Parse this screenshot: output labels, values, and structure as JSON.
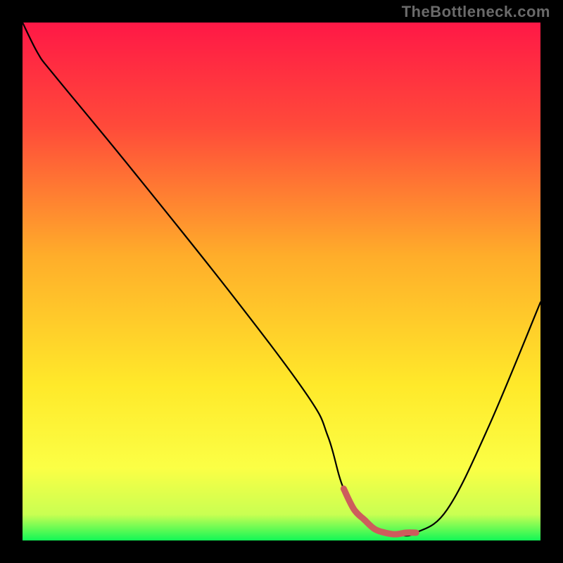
{
  "watermark": "TheBottleneck.com",
  "chart_data": {
    "type": "line",
    "title": "",
    "xlabel": "",
    "ylabel": "",
    "xlim": [
      0,
      100
    ],
    "ylim": [
      0,
      100
    ],
    "grid": false,
    "legend": false,
    "gradient_stops": [
      {
        "offset": 0,
        "color": "#ff1846"
      },
      {
        "offset": 20,
        "color": "#ff4a3a"
      },
      {
        "offset": 45,
        "color": "#ffad2a"
      },
      {
        "offset": 70,
        "color": "#ffe92a"
      },
      {
        "offset": 86,
        "color": "#fbff45"
      },
      {
        "offset": 95,
        "color": "#c9ff52"
      },
      {
        "offset": 100,
        "color": "#12f756"
      }
    ],
    "series": [
      {
        "name": "bottleneck-curve",
        "x": [
          0,
          3,
          6,
          20,
          40,
          55,
          59,
          62,
          66,
          70,
          73,
          76,
          82,
          90,
          100
        ],
        "y": [
          100,
          94,
          90,
          73,
          48,
          28,
          20,
          10,
          4,
          1.5,
          1.0,
          1.5,
          6,
          22,
          46
        ]
      }
    ],
    "trough_highlight": {
      "name": "optimal-range",
      "color": "#cd5c5c",
      "x": [
        62,
        64,
        66,
        68,
        70,
        72,
        74,
        76
      ],
      "y": [
        10,
        6,
        4,
        2.2,
        1.5,
        1.2,
        1.5,
        1.5
      ]
    }
  }
}
